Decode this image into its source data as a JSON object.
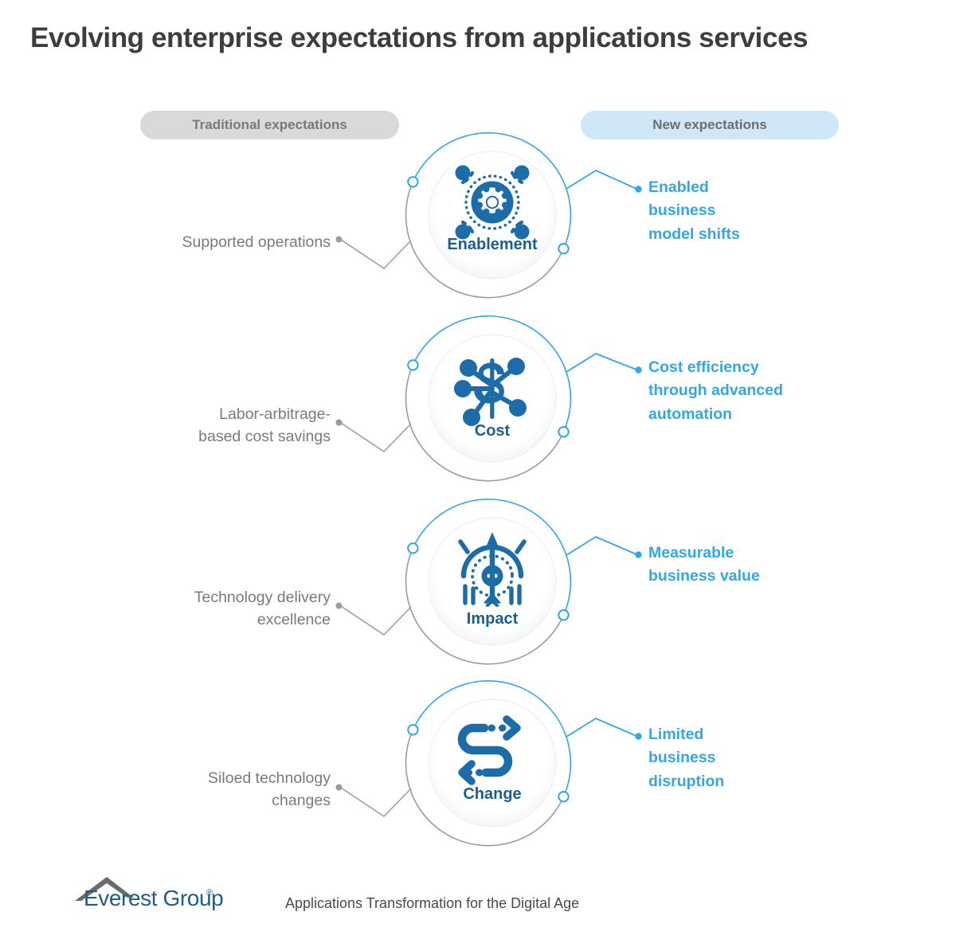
{
  "page": {
    "title": "Evolving enterprise expectations from applications services",
    "background_color": "#ffffff"
  },
  "colors": {
    "title_text": "#3d3d3d",
    "traditional_pill_bg": "#d9d9d9",
    "new_pill_bg": "#cfe7f7",
    "traditional_text": "#7a7a7a",
    "new_text": "#32a7e8",
    "ring_blue": "#32a7e8",
    "ring_gray": "#9b9b9b",
    "icon_dark_blue": "#1a5f8f",
    "icon_mid_blue": "#1b6ca8",
    "logo_blue": "#1f5c8b",
    "logo_gray": "#6b6b6b"
  },
  "columns": {
    "traditional": {
      "label": "Traditional expectations"
    },
    "new": {
      "label": "New expectations"
    }
  },
  "rows": [
    {
      "id": "enablement",
      "ring_label": "Enablement",
      "icon": "gear-network-icon",
      "traditional": "Supported operations",
      "traditional_lines": [
        "Supported operations"
      ],
      "new": "Enabled business model shifts",
      "new_lines": [
        "Enabled",
        "business",
        "model shifts"
      ]
    },
    {
      "id": "cost",
      "ring_label": "Cost",
      "icon": "dollar-network-icon",
      "traditional": "Labor-arbitrage-based cost savings",
      "traditional_lines": [
        "Labor-arbitrage-",
        "based cost savings"
      ],
      "new": "Cost efficiency through advanced automation",
      "new_lines": [
        "Cost efficiency",
        "through advanced",
        "automation"
      ]
    },
    {
      "id": "impact",
      "ring_label": "Impact",
      "icon": "arrow-target-icon",
      "traditional": "Technology delivery excellence",
      "traditional_lines": [
        "Technology delivery",
        "excellence"
      ],
      "new": "Measurable business value",
      "new_lines": [
        "Measurable",
        "business value"
      ]
    },
    {
      "id": "change",
      "ring_label": "Change",
      "icon": "winding-path-arrows-icon",
      "traditional": "Siloed technology changes",
      "traditional_lines": [
        "Siloed technology",
        "changes"
      ],
      "new": "Limited business disruption",
      "new_lines": [
        "Limited",
        "business",
        "disruption"
      ]
    }
  ],
  "footer": {
    "logo_wordmark": "Everest Group",
    "logo_registered": "®",
    "tagline": "Applications Transformation for the Digital Age"
  }
}
